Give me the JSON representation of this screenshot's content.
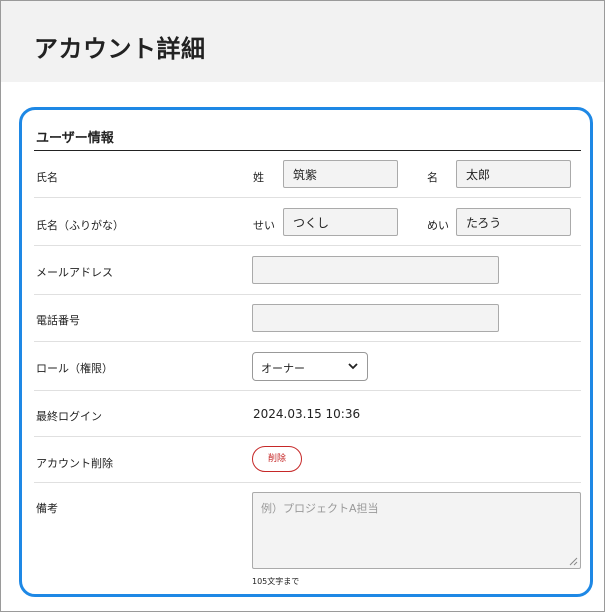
{
  "header": {
    "title": "アカウント詳細"
  },
  "section": {
    "title": "ユーザー情報"
  },
  "fields": {
    "name": {
      "label": "氏名",
      "last_label": "姓",
      "last_value": "筑紫",
      "first_label": "名",
      "first_value": "太郎"
    },
    "kana": {
      "label": "氏名（ふりがな）",
      "last_label": "せい",
      "last_value": "つくし",
      "first_label": "めい",
      "first_value": "たろう"
    },
    "email": {
      "label": "メールアドレス",
      "value": ""
    },
    "phone": {
      "label": "電話番号",
      "value": ""
    },
    "role": {
      "label": "ロール（権限）",
      "selected": "オーナー"
    },
    "last_login": {
      "label": "最終ログイン",
      "value": "2024.03.15 10:36"
    },
    "delete_account": {
      "label": "アカウント削除",
      "button": "削除"
    },
    "notes": {
      "label": "備考",
      "placeholder": "例）プロジェクトA担当",
      "note": "105文字まで"
    }
  },
  "colors": {
    "accent": "#1e88e5",
    "danger": "#c62828",
    "header_bg": "#f2f2f2"
  },
  "icons": {
    "select": "chevron-down-icon",
    "textarea": "resize-grip-icon"
  }
}
